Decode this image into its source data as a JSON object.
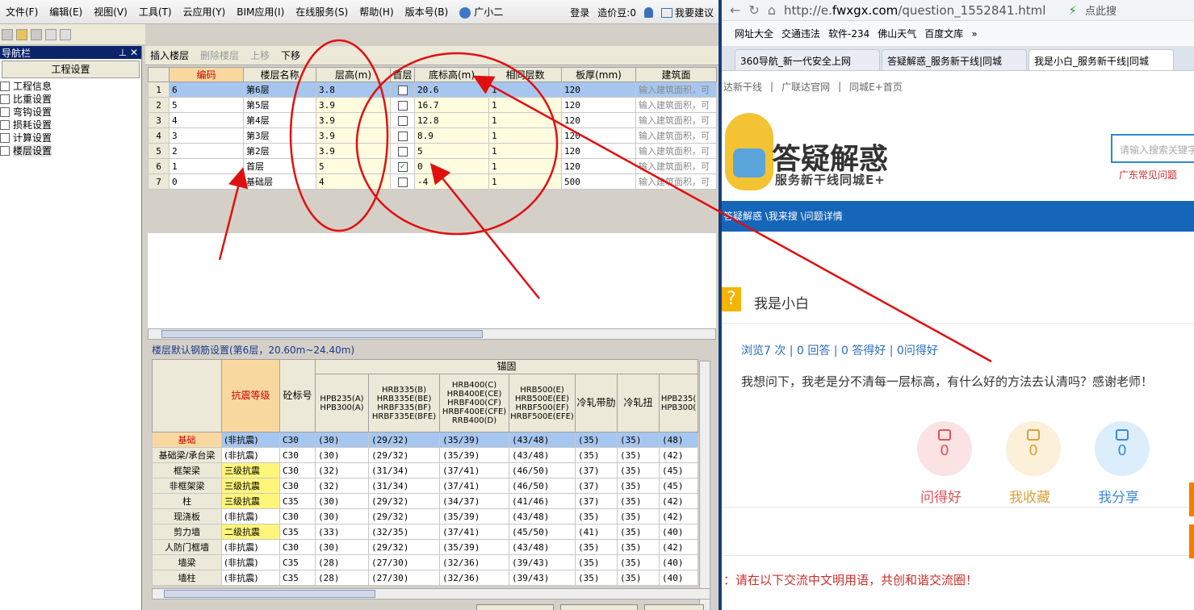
{
  "app": {
    "menu": [
      "文件(F)",
      "编辑(E)",
      "视图(V)",
      "工具(T)",
      "云应用(Y)",
      "BIM应用(I)",
      "在线服务(S)",
      "帮助(H)",
      "版本号(B)",
      "广小二"
    ],
    "login": "登录",
    "price": "造价豆:0",
    "suggest": "我要建议"
  },
  "nav": {
    "title": "导航栏",
    "tab": "工程设置",
    "items": [
      "工程信息",
      "比重设置",
      "弯钩设置",
      "损耗设置",
      "计算设置",
      "楼层设置"
    ]
  },
  "toolbar": {
    "insert": "插入楼层",
    "delete": "删除楼层",
    "up": "上移",
    "down": "下移"
  },
  "floors": {
    "headers": [
      "编码",
      "楼层名称",
      "层高(m)",
      "首层",
      "底标高(m)",
      "相同层数",
      "板厚(mm)",
      "建筑面"
    ],
    "rows": [
      {
        "n": "1",
        "code": "6",
        "name": "第6层",
        "h": "3.8",
        "first": false,
        "base": "20.6",
        "same": "1",
        "slab": "120",
        "area": "输入建筑面积，可"
      },
      {
        "n": "2",
        "code": "5",
        "name": "第5层",
        "h": "3.9",
        "first": false,
        "base": "16.7",
        "same": "1",
        "slab": "120",
        "area": "输入建筑面积，可"
      },
      {
        "n": "3",
        "code": "4",
        "name": "第4层",
        "h": "3.9",
        "first": false,
        "base": "12.8",
        "same": "1",
        "slab": "120",
        "area": "输入建筑面积，可"
      },
      {
        "n": "4",
        "code": "3",
        "name": "第3层",
        "h": "3.9",
        "first": false,
        "base": "8.9",
        "same": "1",
        "slab": "120",
        "area": "输入建筑面积，可"
      },
      {
        "n": "5",
        "code": "2",
        "name": "第2层",
        "h": "3.9",
        "first": false,
        "base": "5",
        "same": "1",
        "slab": "120",
        "area": "输入建筑面积，可"
      },
      {
        "n": "6",
        "code": "1",
        "name": "首层",
        "h": "5",
        "first": true,
        "base": "0",
        "same": "1",
        "slab": "120",
        "area": "输入建筑面积，可"
      },
      {
        "n": "7",
        "code": "0",
        "name": "基础层",
        "h": "4",
        "first": false,
        "base": "-4",
        "same": "1",
        "slab": "500",
        "area": "输入建筑面积，可"
      }
    ]
  },
  "rebar": {
    "title": "楼层默认钢筋设置(第6层，20.60m~24.40m)",
    "anchor": "锚固",
    "headers": [
      "抗震等级",
      "砼标号",
      "HPB235(A) HPB300(A)",
      "HRB335(B) HRB335E(BE) HRBF335(BF) HRBF335E(BFE)",
      "HRB400(C) HRB400E(CE) HRBF400(CF) HRBF400E(CFE) RRB400(D)",
      "HRB500(E) HRB500E(EE) HRBF500(EF) HRBF500E(EFE)",
      "冷轧带肋",
      "冷轧扭",
      "HPB235( HPB300("
    ],
    "rows": [
      {
        "name": "基础",
        "level": "(非抗震)",
        "c": "C30",
        "v": [
          "(30)",
          "(29/32)",
          "(35/39)",
          "(43/48)",
          "(35)",
          "(35)",
          "(48)"
        ]
      },
      {
        "name": "基础梁/承台梁",
        "level": "(非抗震)",
        "c": "C30",
        "v": [
          "(30)",
          "(29/32)",
          "(35/39)",
          "(43/48)",
          "(35)",
          "(35)",
          "(42)"
        ]
      },
      {
        "name": "框架梁",
        "level": "三级抗震",
        "c": "C30",
        "v": [
          "(32)",
          "(31/34)",
          "(37/41)",
          "(46/50)",
          "(37)",
          "(35)",
          "(45)"
        ]
      },
      {
        "name": "非框架梁",
        "level": "三级抗震",
        "c": "C30",
        "v": [
          "(32)",
          "(31/34)",
          "(37/41)",
          "(46/50)",
          "(37)",
          "(35)",
          "(45)"
        ]
      },
      {
        "name": "柱",
        "level": "三级抗震",
        "c": "C35",
        "v": [
          "(30)",
          "(29/32)",
          "(34/37)",
          "(41/46)",
          "(37)",
          "(35)",
          "(42)"
        ]
      },
      {
        "name": "现浇板",
        "level": "(非抗震)",
        "c": "C30",
        "v": [
          "(30)",
          "(29/32)",
          "(35/39)",
          "(43/48)",
          "(35)",
          "(35)",
          "(42)"
        ]
      },
      {
        "name": "剪力墙",
        "level": "二级抗震",
        "c": "C35",
        "v": [
          "(33)",
          "(32/35)",
          "(37/41)",
          "(45/50)",
          "(41)",
          "(35)",
          "(40)"
        ]
      },
      {
        "name": "人防门框墙",
        "level": "(非抗震)",
        "c": "C30",
        "v": [
          "(30)",
          "(29/32)",
          "(35/39)",
          "(43/48)",
          "(35)",
          "(35)",
          "(42)"
        ]
      },
      {
        "name": "墙梁",
        "level": "(非抗震)",
        "c": "C35",
        "v": [
          "(28)",
          "(27/30)",
          "(32/36)",
          "(39/43)",
          "(35)",
          "(35)",
          "(40)"
        ]
      },
      {
        "name": "墙柱",
        "level": "(非抗震)",
        "c": "C35",
        "v": [
          "(28)",
          "(27/30)",
          "(32/36)",
          "(39/43)",
          "(35)",
          "(35)",
          "(40)"
        ]
      }
    ]
  },
  "browser": {
    "url_pre": "http://e.",
    "url_host": "fwxgx.com",
    "url_path": "/question_1552841.html",
    "url_hint": "点此搜",
    "bookmarks": [
      "网址大全",
      "交通违法",
      "软件-234",
      "佛山天气",
      "百度文库"
    ],
    "tabs": [
      "360导航_新一代安全上网",
      "答疑解惑_服务新干线|同城",
      "我是小白_服务新干线|同城"
    ],
    "links": [
      "达新干线",
      "广联达官网",
      "同城E+首页"
    ],
    "brand": "答疑解惑",
    "brand_sub": "服务新干线同城E+",
    "search_placeholder": "请输入搜索关键字",
    "faq": "广东常见问题",
    "breadcrumb": "答疑解惑 \\我来搜 \\问题详情",
    "user": "我是小白",
    "stats": "浏览7 次 | 0 回答 | 0 答得好 | 0问得好",
    "question": "我想问下，我老是分不清每一层标高，有什么好的方法去认清吗？感谢老师！",
    "actions": [
      {
        "n": "0",
        "label": "问得好",
        "color": "#e0525a",
        "bg": "#fbe3e4"
      },
      {
        "n": "0",
        "label": "我收藏",
        "color": "#d9a23a",
        "bg": "#fdf0d9"
      },
      {
        "n": "0",
        "label": "我分享",
        "color": "#3a8ad9",
        "bg": "#dceefb"
      }
    ],
    "notice": "：请在以下交流中文明用语，共创和谐交流圈！"
  }
}
